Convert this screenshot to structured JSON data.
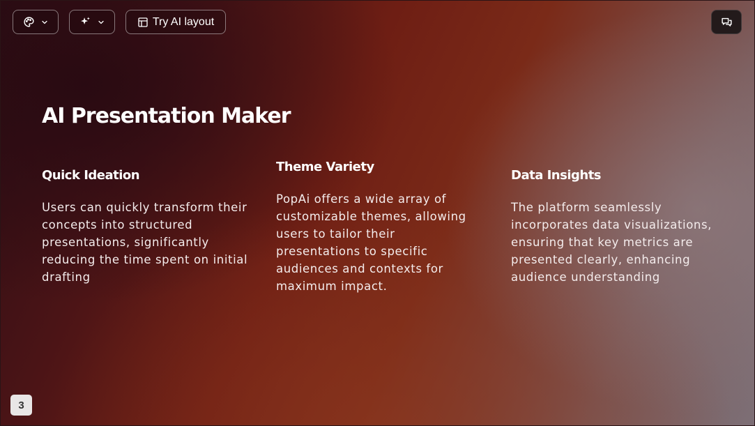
{
  "toolbar": {
    "theme_icon": "palette-icon",
    "ai_icon": "sparkles-icon",
    "layout_icon": "layout-icon",
    "layout_label": "Try AI layout",
    "chat_icon": "chat-icon"
  },
  "slide": {
    "title": "AI Presentation Maker",
    "columns": [
      {
        "heading": "Quick Ideation",
        "body": "Users can quickly transform their concepts into structured presentations, significantly reducing the time spent on initial drafting"
      },
      {
        "heading": "Theme Variety",
        "body": "PopAi offers a wide array of customizable themes, allowing users to tailor their presentations to specific audiences and contexts for maximum impact."
      },
      {
        "heading": "Data Insights",
        "body": "The platform seamlessly incorporates data visualizations, ensuring that key metrics are presented clearly, enhancing audience understanding"
      }
    ]
  },
  "page_number": "3",
  "colors": {
    "background_dark": "#2c0d14",
    "background_red": "#6e1e14",
    "background_gray": "#7d6f76",
    "text": "#ffffff"
  }
}
